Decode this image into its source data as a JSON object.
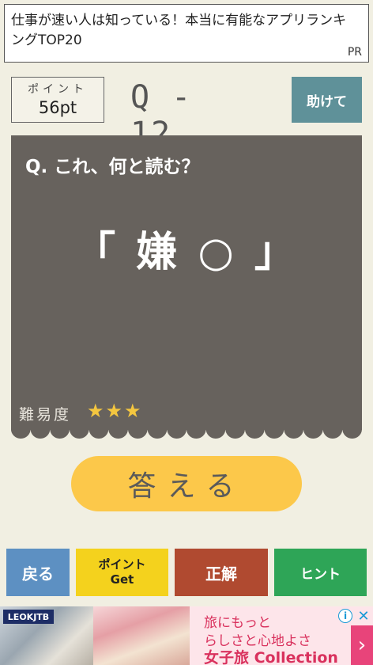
{
  "pr_banner": {
    "text": "仕事が速い人は知っている！本当に有能なアプリランキングTOP20",
    "tag": "PR"
  },
  "points": {
    "label": "ポイント",
    "value": "56pt"
  },
  "question_number": "Q - 12",
  "help_button": "助けて",
  "question": {
    "prompt": "Q. これ、何と読む？",
    "kanji": "「 嫌 ○ 」",
    "difficulty_label": "難易度",
    "stars": "★★★",
    "difficulty_level": 3
  },
  "answer_button": "答える",
  "bottom_buttons": {
    "back": "戻る",
    "get_points_line1": "ポイント",
    "get_points_line2": "Get",
    "answer_reveal": "正解",
    "hint": "ヒント"
  },
  "ad": {
    "logo": "LEOKJTB",
    "line1": "旅にもっと",
    "line2": "らしさと心地よさ",
    "line3": "女子旅 Collection",
    "info_icon": "info-icon",
    "close_icon": "close-icon"
  },
  "colors": {
    "background": "#f1efe2",
    "card": "#67625d",
    "answer_button": "#fcc84a",
    "help_button": "#5f9199",
    "back_button": "#5d90c2",
    "get_points_button": "#f4d21d",
    "answer_reveal_button": "#b04a30",
    "hint_button": "#2ea557",
    "stars": "#f4c63f"
  }
}
